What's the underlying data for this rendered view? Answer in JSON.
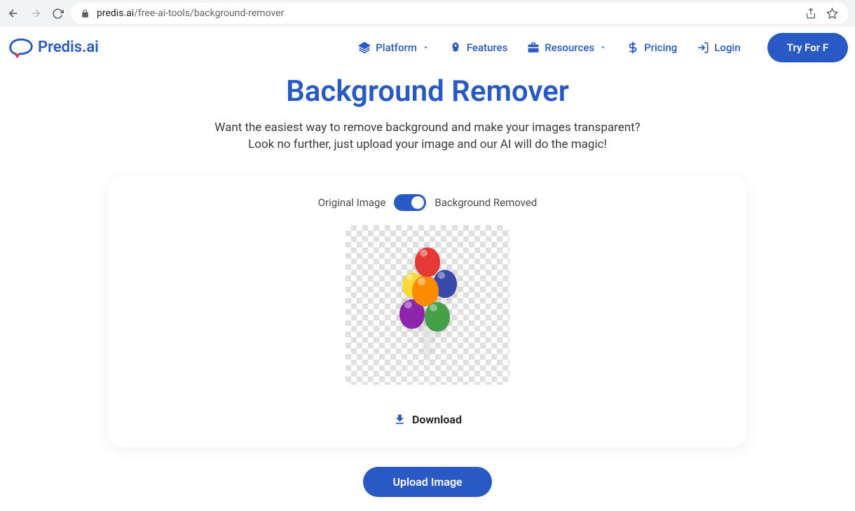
{
  "browser": {
    "url_host": "predis.ai",
    "url_path": "/free-ai-tools/background-remover"
  },
  "header": {
    "logo_text": "Predis.ai",
    "nav": {
      "platform": "Platform",
      "features": "Features",
      "resources": "Resources",
      "pricing": "Pricing",
      "login": "Login",
      "cta": "Try For F"
    }
  },
  "page": {
    "title": "Background Remover",
    "subtitle_line1": "Want the easiest way to remove background and make your images transparent?",
    "subtitle_line2": "Look no further, just upload your image and our AI will do the magic!"
  },
  "card": {
    "toggle_left": "Original Image",
    "toggle_right": "Background Removed",
    "toggle_state": "right",
    "download_label": "Download"
  },
  "actions": {
    "upload_label": "Upload Image"
  },
  "colors": {
    "primary": "#2859c5"
  }
}
